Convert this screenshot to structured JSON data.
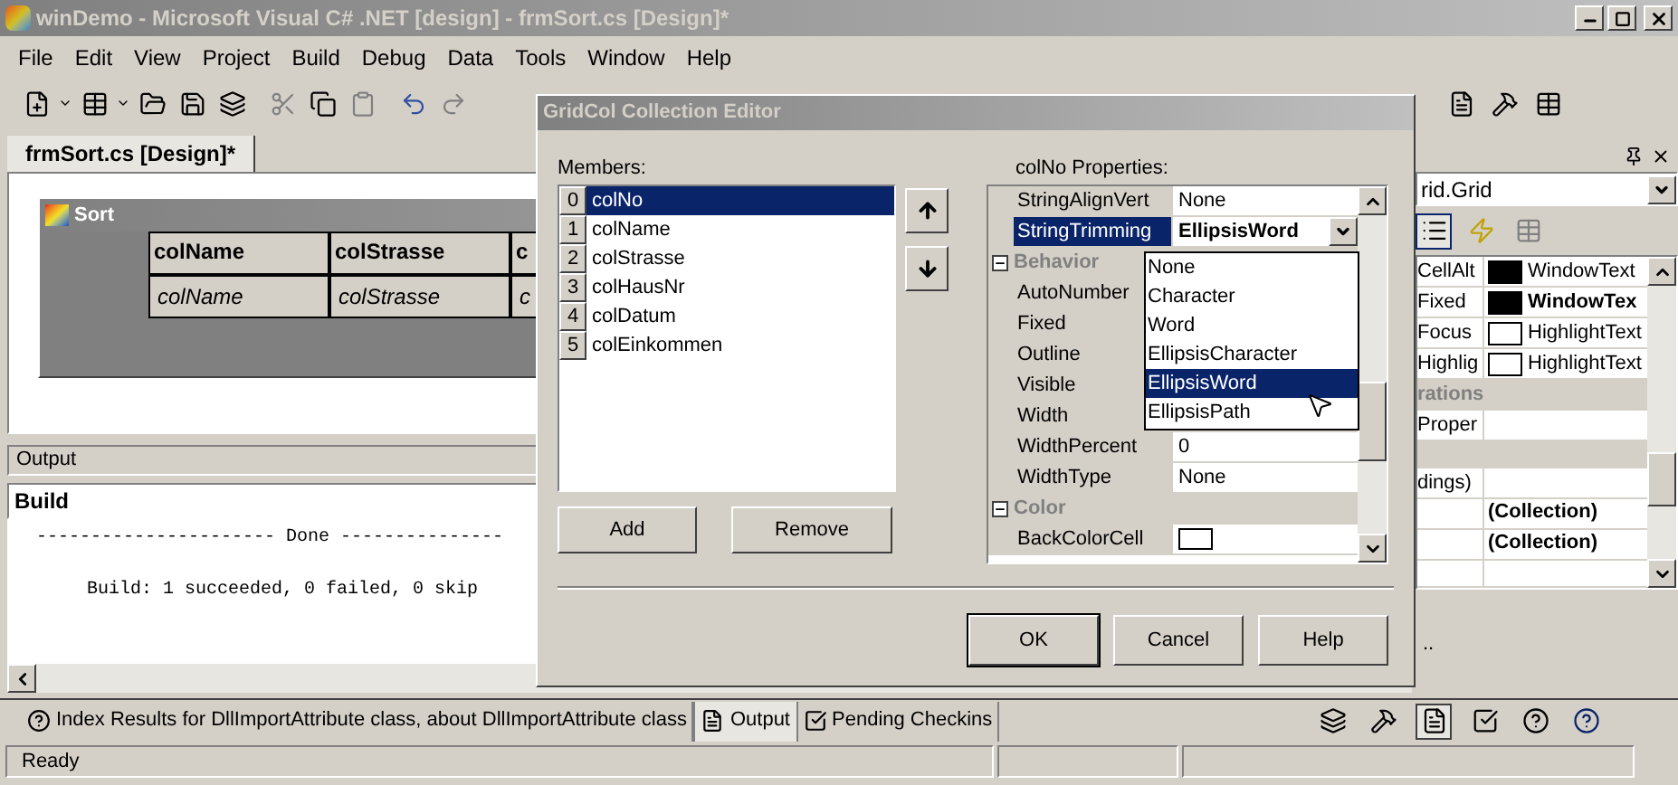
{
  "window": {
    "title": "winDemo - Microsoft Visual C# .NET [design] - frmSort.cs [Design]*"
  },
  "menu": [
    "File",
    "Edit",
    "View",
    "Project",
    "Build",
    "Debug",
    "Data",
    "Tools",
    "Window",
    "Help"
  ],
  "document_tabs": [
    {
      "label": "frmSort.cs [Design]*",
      "selected": true
    }
  ],
  "form_designer": {
    "title": "Sort",
    "columns": [
      "colName",
      "colStrasse",
      "c"
    ],
    "row": [
      "colName",
      "colStrasse",
      "c"
    ]
  },
  "output": {
    "title": "Output",
    "pane": "Build",
    "lines": [
      "---------------------- Done ---------------",
      "Build: 1 succeeded, 0 failed, 0 skip"
    ]
  },
  "properties_panel": {
    "object": "rid.Grid",
    "rows": [
      {
        "kind": "color",
        "name": "CellAlt",
        "color": "#000000",
        "value": "WindowText",
        "bold": false
      },
      {
        "kind": "color",
        "name": "Fixed",
        "color": "#000000",
        "value": "WindowTex",
        "bold": true
      },
      {
        "kind": "color",
        "name": "Focus",
        "color": "#ffffff",
        "value": "HighlightText",
        "bold": false
      },
      {
        "kind": "color",
        "name": "Highlig",
        "color": "#ffffff",
        "value": "HighlightText",
        "bold": false
      },
      {
        "kind": "category",
        "name": "rations"
      },
      {
        "kind": "text",
        "name": "Proper"
      },
      {
        "kind": "category"
      },
      {
        "kind": "text",
        "name": "dings)"
      },
      {
        "kind": "text",
        "value": "(Collection)",
        "bold": true
      },
      {
        "kind": "text",
        "value": "(Collection)",
        "bold": true
      },
      {
        "kind": "text"
      }
    ],
    "description": ".."
  },
  "bottom_tabs": [
    {
      "label": "Index Results for DllImportAttribute class, about DllImportAttribute class",
      "selected": false
    },
    {
      "label": "Output",
      "selected": true
    },
    {
      "label": "Pending Checkins",
      "selected": false
    }
  ],
  "status_bar": {
    "text": "Ready"
  },
  "dialog": {
    "title": "GridCol Collection Editor",
    "members_label": "Members:",
    "members": [
      {
        "index": "0",
        "name": "colNo",
        "selected": true
      },
      {
        "index": "1",
        "name": "colName",
        "selected": false
      },
      {
        "index": "2",
        "name": "colStrasse",
        "selected": false
      },
      {
        "index": "3",
        "name": "colHausNr",
        "selected": false
      },
      {
        "index": "4",
        "name": "colDatum",
        "selected": false
      },
      {
        "index": "5",
        "name": "colEinkommen",
        "selected": false
      }
    ],
    "member_buttons": [
      "Add",
      "Remove"
    ],
    "properties_label": "colNo Properties:",
    "properties": [
      {
        "kind": "property",
        "name": "StringAlignVert",
        "value": "None",
        "selected": false,
        "bold": false
      },
      {
        "kind": "dropdown",
        "name": "StringTrimming",
        "value": "EllipsisWord",
        "selected": true,
        "bold": true
      },
      {
        "kind": "category",
        "name": "Behavior",
        "expanded": true
      },
      {
        "kind": "property",
        "name": "AutoNumber",
        "selected": false
      },
      {
        "kind": "property",
        "name": "Fixed",
        "selected": false
      },
      {
        "kind": "property",
        "name": "Outline",
        "selected": false
      },
      {
        "kind": "property",
        "name": "Visible",
        "selected": false
      },
      {
        "kind": "property",
        "name": "Width",
        "selected": false
      },
      {
        "kind": "property",
        "name": "WidthPercent",
        "value": "0",
        "selected": false,
        "bold": false
      },
      {
        "kind": "property",
        "name": "WidthType",
        "value": "None",
        "selected": false,
        "bold": false
      },
      {
        "kind": "category",
        "name": "Color",
        "expanded": true
      },
      {
        "kind": "color",
        "name": "BackColorCell",
        "color": "#ffffff",
        "selected": false
      }
    ],
    "dropdown_options": [
      {
        "label": "None",
        "selected": false
      },
      {
        "label": "Character",
        "selected": false
      },
      {
        "label": "Word",
        "selected": false
      },
      {
        "label": "EllipsisCharacter",
        "selected": false
      },
      {
        "label": "EllipsisWord",
        "selected": true
      },
      {
        "label": "EllipsisPath",
        "selected": false
      }
    ],
    "buttons": [
      "OK",
      "Cancel",
      "Help"
    ]
  }
}
